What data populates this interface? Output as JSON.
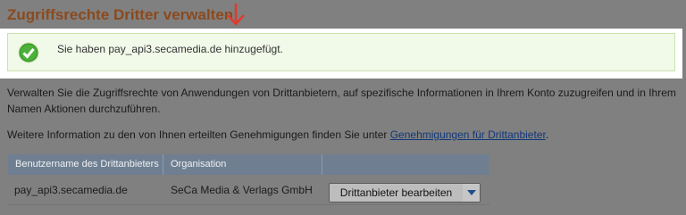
{
  "page": {
    "title": "Zugriffsrechte Dritter verwalten"
  },
  "success": {
    "message": "Sie haben pay_api3.secamedia.de hinzugefügt."
  },
  "description": "Verwalten Sie die Zugriffsrechte von Anwendungen von Drittanbietern, auf spezifische Informationen in Ihrem Konto zuzugreifen und in Ihrem Namen Aktionen durchzuführen.",
  "info": {
    "text": "Weitere Information zu den von Ihnen erteilten Genehmigungen finden Sie unter ",
    "link_label": "Genehmigungen für Drittanbieter",
    "suffix": "."
  },
  "table": {
    "headers": [
      "Benutzername des Drittanbieters",
      "Organisation",
      ""
    ],
    "rows": [
      {
        "username": "pay_api3.secamedia.de",
        "organisation": "SeCa Media & Verlags GmbH",
        "action_label": "Drittanbieter bearbeiten"
      }
    ]
  },
  "colors": {
    "title": "#8a4a1e",
    "annotation_arrow": "#e03a2c",
    "success_bg": "#f1f9e9",
    "check": "#3a9a2a",
    "table_header": "#6f7f91"
  },
  "icons": {
    "annotation": "red-down-arrow-icon",
    "success": "checkmark-circle-icon",
    "dropdown": "chevron-down-icon"
  }
}
